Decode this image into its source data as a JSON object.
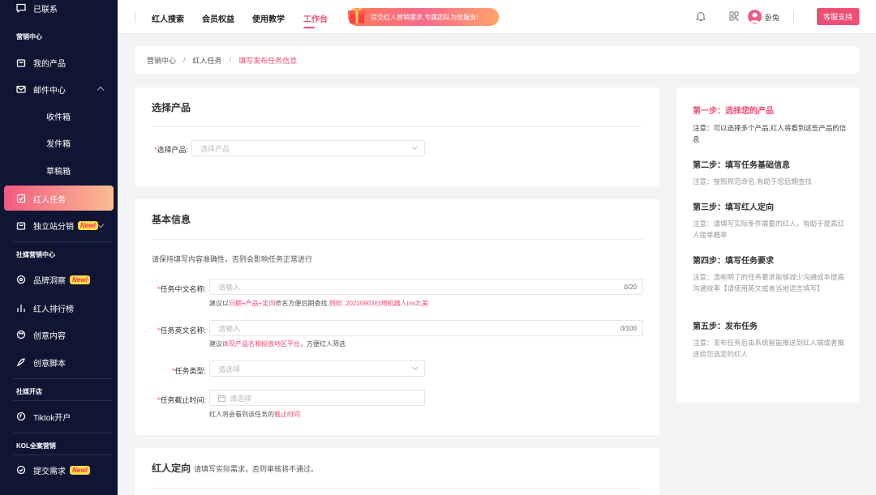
{
  "sidebar": {
    "top_item": "已联系",
    "group_marketing": "营销中心",
    "my_products": "我的产品",
    "mail_center": "邮件中心",
    "inbox": "收件箱",
    "outbox": "发件箱",
    "drafts": "草稿箱",
    "influencer_tasks": "红人任务",
    "site_distribution": "独立站分销",
    "group_social": "社媒营销中心",
    "brand_insight": "品牌洞察",
    "influencer_rank": "红人排行榜",
    "creative_content": "创意内容",
    "creative_script": "创意脚本",
    "group_social_open": "社媒开店",
    "tiktok_open": "Tiktok开户",
    "group_kol": "KOL全案营销",
    "submit_request": "提交需求",
    "new_badge": "New!"
  },
  "topbar": {
    "nav": [
      "红人搜索",
      "会员权益",
      "使用教学",
      "工作台"
    ],
    "banner_text": "提交红人营销需求,专属团队为您服务!",
    "username": "卧兔",
    "support_button": "客服支持"
  },
  "breadcrumb": [
    "营销中心",
    "红人任务",
    "填写发布任务信息"
  ],
  "select_product": {
    "title": "选择产品",
    "label": "选择产品:",
    "placeholder": "选择产品"
  },
  "basic_info": {
    "title": "基本信息",
    "note": "请保持填写内容准确性，否则会影响任务正常进行",
    "cn_name_label": "任务中文名称:",
    "cn_name_placeholder": "请输入",
    "cn_name_count": "0/20",
    "cn_hint_a": "建议以",
    "cn_hint_b": "日期+产品+定向",
    "cn_hint_c": "命名方便后期查找,",
    "cn_hint_d": "例如: 20210903扫地机器人ins北美",
    "en_name_label": "任务英文名称:",
    "en_name_placeholder": "请输入",
    "en_name_count": "0/100",
    "en_hint_a": "建议",
    "en_hint_b": "体现产品名和投放地区平台",
    "en_hint_c": "，方便红人筛选",
    "type_label": "任务类型:",
    "type_placeholder": "请选择",
    "deadline_label": "任务截止时间:",
    "deadline_placeholder": "请选择",
    "deadline_hint_a": "红人将会看到该任务的",
    "deadline_hint_b": "截止时间"
  },
  "targeting": {
    "title": "红人定向",
    "subtitle": "请填写实际需求，否则审核将不通过。"
  },
  "steps": [
    {
      "title": "第一步：选择您的产品",
      "note": "注意：可以选择多个产品,红人将看到这些产品的信息"
    },
    {
      "title": "第二步：填写任务基础信息",
      "note": "注意：按照规范命名,有助于您后期查找"
    },
    {
      "title": "第三步：填写红人定向",
      "note": "注意：请填写实际条件需要的红人，有助于提高红人接单概率"
    },
    {
      "title": "第四步：填写任务要求",
      "note": "注意：清晰明了的任务要求能够减少沟通成本提高沟通效率【请使用英文或者当地语言填写】"
    },
    {
      "title": "第五步：发布任务",
      "note": "注意：发布任务后由系统智能推送到红人端或者推送给您选定的红人"
    }
  ],
  "colors": {
    "accent": "#ee4d74",
    "sidebar_bg": "#0f1533"
  }
}
